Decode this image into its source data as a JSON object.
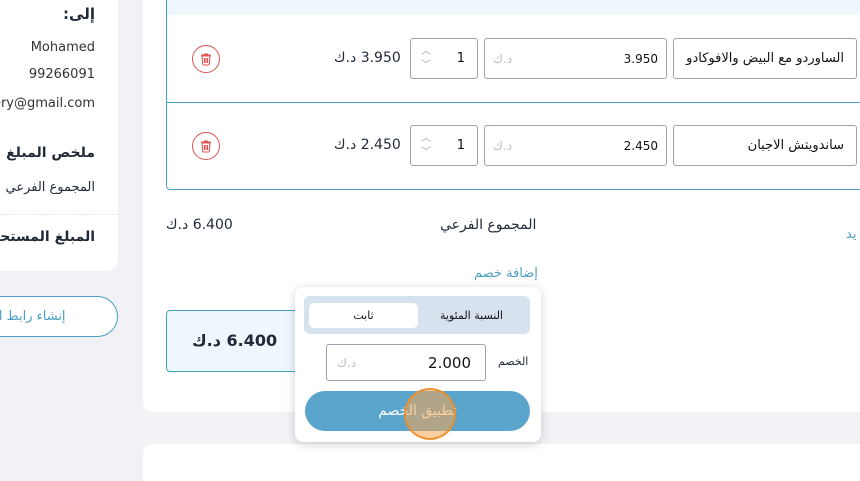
{
  "customer": {
    "to_label": "إلى:",
    "name": "Mohamed",
    "phone": "99266091",
    "email": "nery@gmail.com"
  },
  "summary": {
    "title": "ملخص المبلغ",
    "subtotal_label": "المجموع الفرعي",
    "amount_due_label": "المبلغ المستحق",
    "create_link_button": "إنشاء رابط الفاتورة"
  },
  "items": [
    {
      "name": "الساوردو مع البيض والافوكادو",
      "price": "3.950",
      "currency_placeholder": "د.ك",
      "quantity": "1",
      "line_total": "3.950 د.ك"
    },
    {
      "name": "ساندويتش الاجبان",
      "price": "2.450",
      "currency_placeholder": "د.ك",
      "quantity": "1",
      "line_total": "2.450 د.ك"
    }
  ],
  "totals": {
    "subtotal_label": "المجموع الفرعي",
    "subtotal_value": "6.400 د.ك",
    "add_discount_link": "إضافة خصم",
    "edge_link": "يد",
    "total_value": "6.400 د.ك"
  },
  "discount_popover": {
    "tab_percent": "النسبة المئوية",
    "tab_fixed": "ثابت",
    "active_tab": "ثابت",
    "discount_label": "الخصم",
    "discount_value": "2.000",
    "currency_placeholder": "د.ك",
    "apply_button": "تطبيق الخصم"
  },
  "colors": {
    "accent": "#4a9ec4",
    "apply_button": "#5ba5cc",
    "delete": "#e05353",
    "page_bg": "#f1f2f6"
  }
}
